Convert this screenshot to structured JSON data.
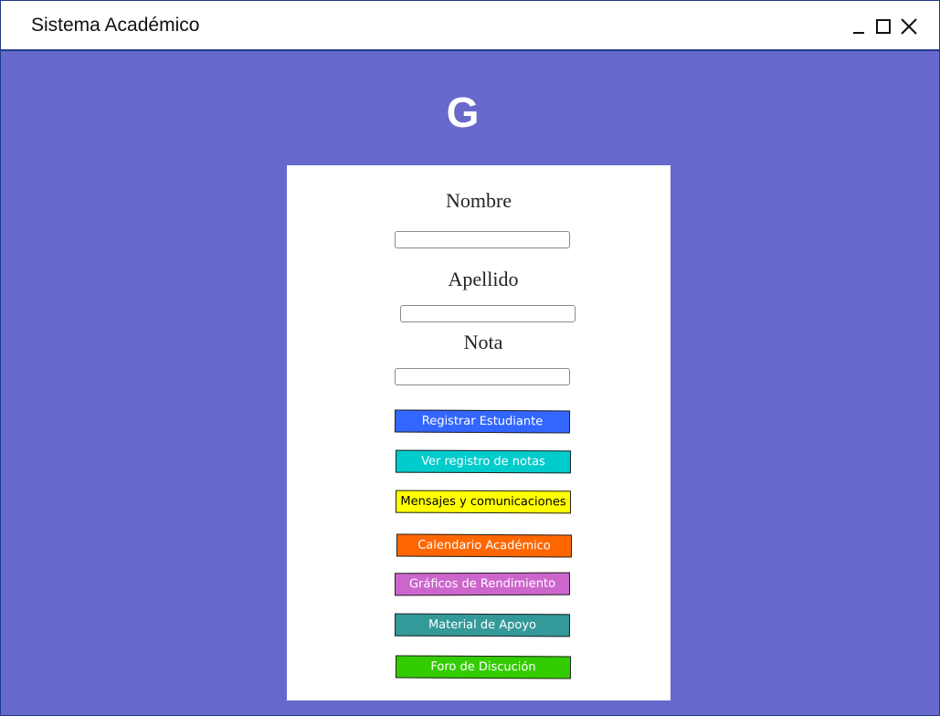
{
  "window": {
    "title": "Sistema Académico",
    "controls": [
      "minimize-icon",
      "maximize-icon",
      "close-icon"
    ]
  },
  "logo": {
    "text": "G"
  },
  "form": {
    "nombre_label": "Nombre",
    "nombre_value": "",
    "apellido_label": "Apellido",
    "apellido_value": "",
    "nota_label": "Nota",
    "nota_value": ""
  },
  "buttons": [
    {
      "label": "Registrar Estudiante",
      "color": "#3366ff",
      "text_color": "#ffffff"
    },
    {
      "label": "Ver registro de notas",
      "color": "#00cccc",
      "text_color": "#ffffff"
    },
    {
      "label": "Mensajes y comunicaciones",
      "color": "#ffff00",
      "text_color": "#000000"
    },
    {
      "label": "Calendario Académico",
      "color": "#ff6600",
      "text_color": "#ffffff"
    },
    {
      "label": "Gráficos de Rendimiento",
      "color": "#cc66cc",
      "text_color": "#ffffff"
    },
    {
      "label": "Material de Apoyo",
      "color": "#339999",
      "text_color": "#ffffff"
    },
    {
      "label": "Foro de Discución",
      "color": "#33cc00",
      "text_color": "#ffffff"
    }
  ],
  "colors": {
    "background": "#6869cc",
    "panel": "#ffffff",
    "border": "#1f3a8a"
  }
}
